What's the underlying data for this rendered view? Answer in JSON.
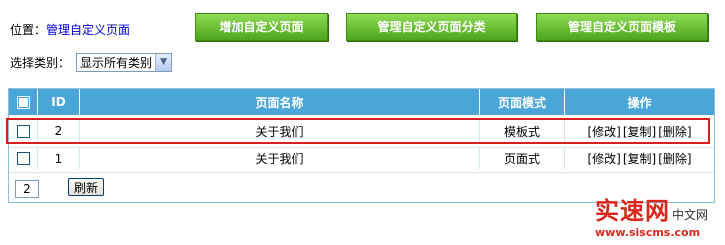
{
  "breadcrumb": {
    "prefix": "位置：",
    "current": "管理自定义页面"
  },
  "toolbar": {
    "add_page": "增加自定义页面",
    "manage_categories": "管理自定义页面分类",
    "manage_templates": "管理自定义页面模板"
  },
  "filter": {
    "label": "选择类别：",
    "selected": "显示所有类别"
  },
  "table": {
    "headers": {
      "id": "ID",
      "name": "页面名称",
      "mode": "页面模式",
      "actions": "操作"
    },
    "rows": [
      {
        "id": "2",
        "name": "关于我们",
        "mode": "模板式",
        "edit": "[修改]",
        "copy": "[复制]",
        "delete": "[删除]"
      },
      {
        "id": "1",
        "name": "关于我们",
        "mode": "页面式",
        "edit": "[修改]",
        "copy": "[复制]",
        "delete": "[删除]"
      }
    ]
  },
  "footer": {
    "page_value": "2",
    "refresh": "刷新"
  },
  "watermark": {
    "big": "实速网",
    "small": "中文网",
    "url": "www.siscms.com"
  },
  "colors": {
    "header_bg": "#4aa6d8",
    "button_green": "#5fb526",
    "highlight_red": "#d81e1e",
    "watermark_red": "#d8281c"
  }
}
